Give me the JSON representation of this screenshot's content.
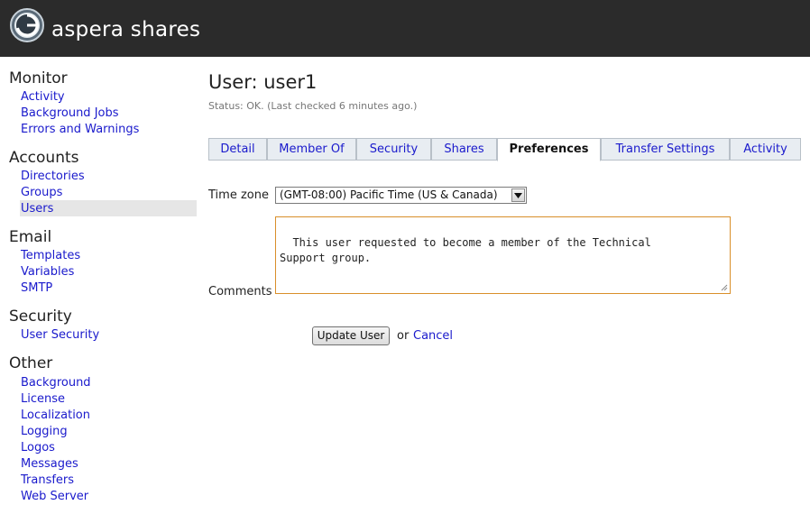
{
  "header": {
    "brand": "aspera shares",
    "logo_icon": "aspera-logo-icon"
  },
  "sidebar": {
    "groups": [
      {
        "heading": "Monitor",
        "items": [
          "Activity",
          "Background Jobs",
          "Errors and Warnings"
        ]
      },
      {
        "heading": "Accounts",
        "items": [
          "Directories",
          "Groups",
          "Users"
        ],
        "active": "Users"
      },
      {
        "heading": "Email",
        "items": [
          "Templates",
          "Variables",
          "SMTP"
        ]
      },
      {
        "heading": "Security",
        "items": [
          "User Security"
        ]
      },
      {
        "heading": "Other",
        "items": [
          "Background",
          "License",
          "Localization",
          "Logging",
          "Logos",
          "Messages",
          "Transfers",
          "Web Server"
        ]
      }
    ]
  },
  "main": {
    "title": "User: user1",
    "status": "Status: OK. (Last checked 6 minutes ago.)",
    "tabs": [
      "Detail",
      "Member Of",
      "Security",
      "Shares",
      "Preferences",
      "Transfer Settings",
      "Activity"
    ],
    "active_tab": "Preferences",
    "form": {
      "timezone_label": "Time zone",
      "timezone_value": "(GMT-08:00) Pacific Time (US & Canada)",
      "comments_label": "Comments",
      "comments_value": "This user requested to become a member of the Technical\nSupport group.",
      "update_button": "Update User",
      "or_text": "or",
      "cancel_link": "Cancel"
    }
  },
  "colors": {
    "header_bg": "#2b2b2b",
    "link": "#1a1acc",
    "textarea_border": "#d98f2a",
    "active_sidebar_bg": "#e6e6e6"
  }
}
